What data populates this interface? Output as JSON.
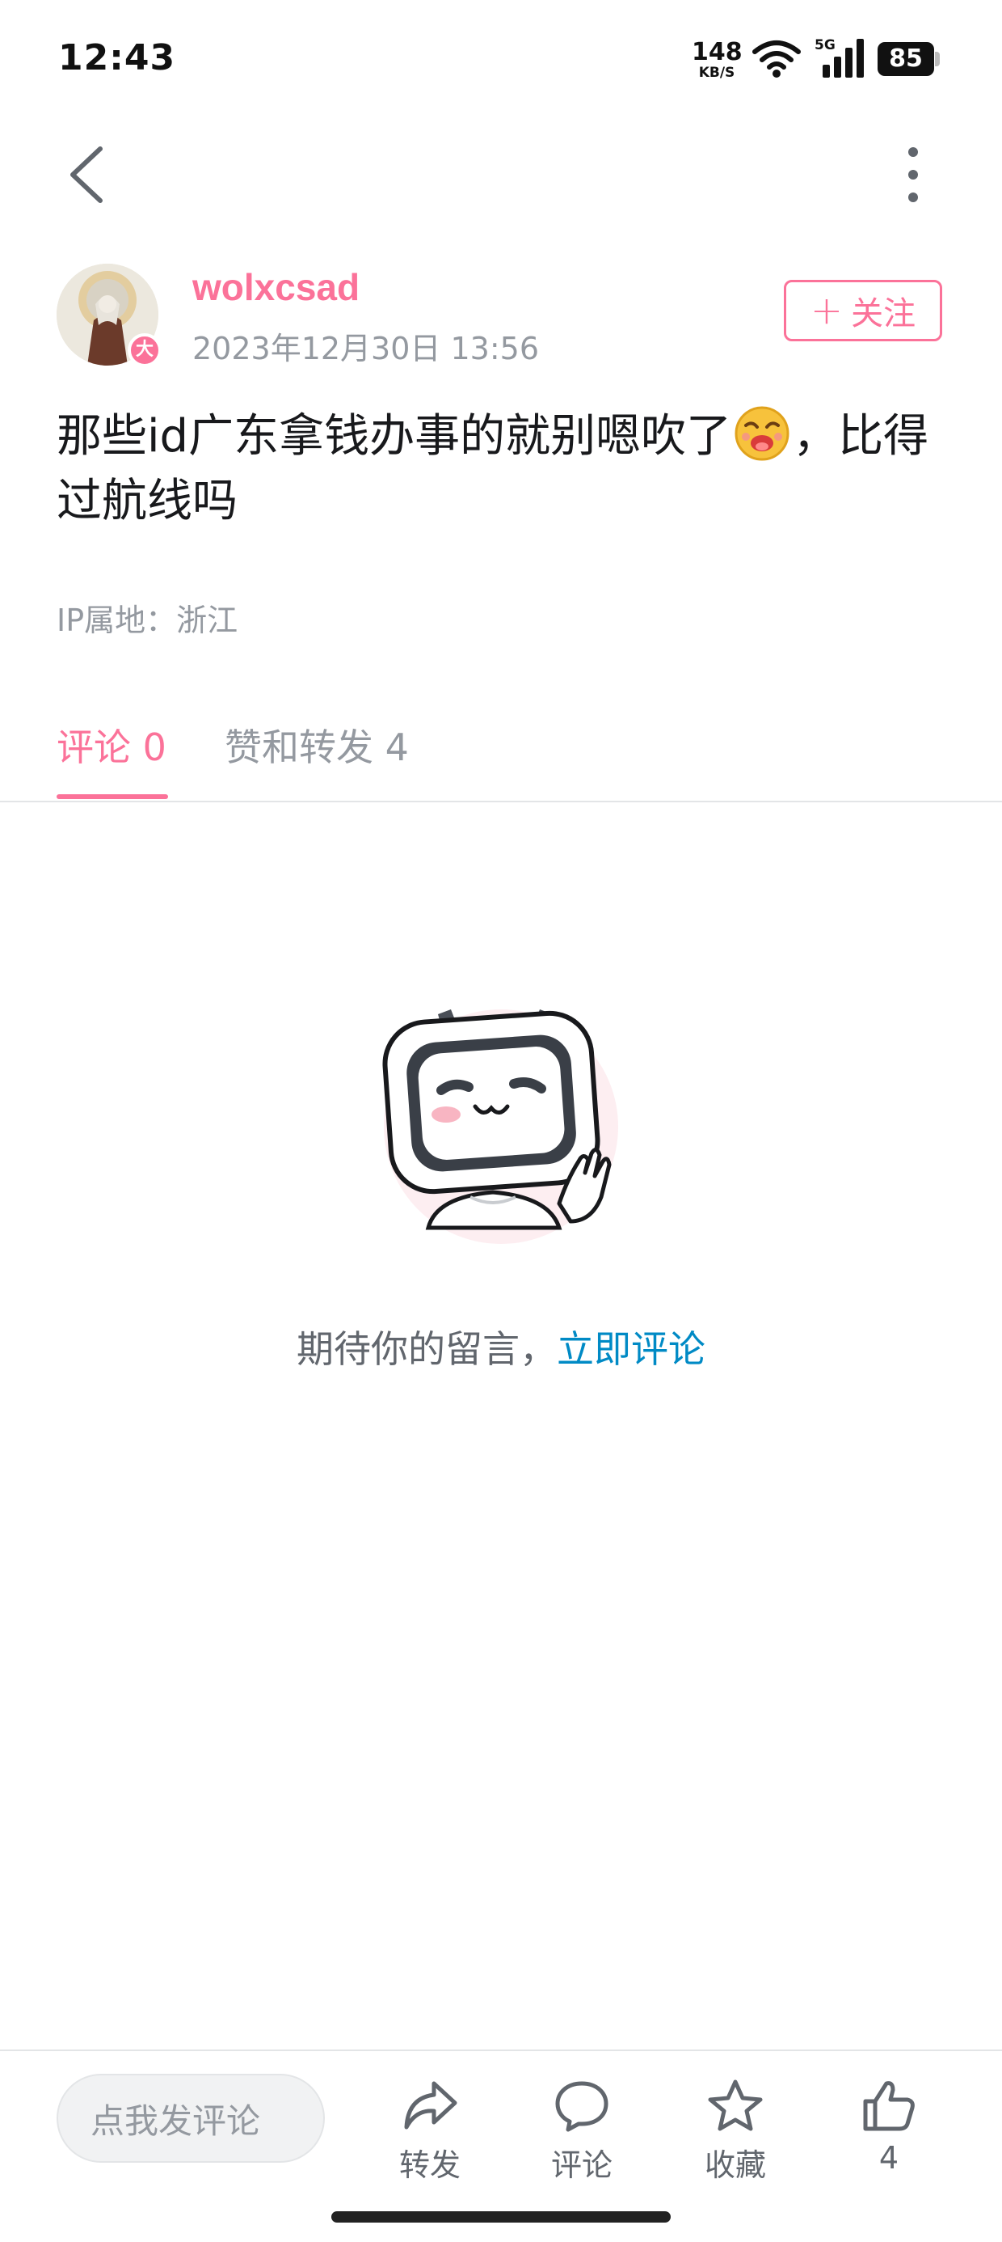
{
  "status_bar": {
    "time": "12:43",
    "net_speed": "148",
    "net_unit": "KB/S",
    "network_tag": "5G",
    "battery": "85"
  },
  "author": {
    "name": "wolxcsad",
    "time": "2023年12月30日 13:56",
    "badge": "大"
  },
  "follow_label": "关注",
  "post": {
    "text_before_emoji": "那些id广东拿钱办事的就别嗯吹了",
    "text_after_emoji": "，比得过航线吗",
    "ip_location": "IP属地：浙江"
  },
  "tabs": {
    "comments": "评论 0",
    "likes_shares": "赞和转发 4"
  },
  "empty_state": {
    "text": "期待你的留言，",
    "link": "立即评论"
  },
  "bottom_bar": {
    "input_placeholder": "点我发评论",
    "share_label": "转发",
    "comment_label": "评论",
    "favorite_label": "收藏",
    "like_count": "4"
  },
  "colors": {
    "brand_pink": "#fb7299",
    "link_blue": "#008ac5",
    "secondary_text": "#9499a0"
  },
  "icons": [
    "back-icon",
    "more-icon",
    "wifi-icon",
    "signal-icon",
    "battery-icon",
    "emoji-icon",
    "share-icon",
    "comment-icon",
    "star-icon",
    "thumb-up-icon"
  ]
}
